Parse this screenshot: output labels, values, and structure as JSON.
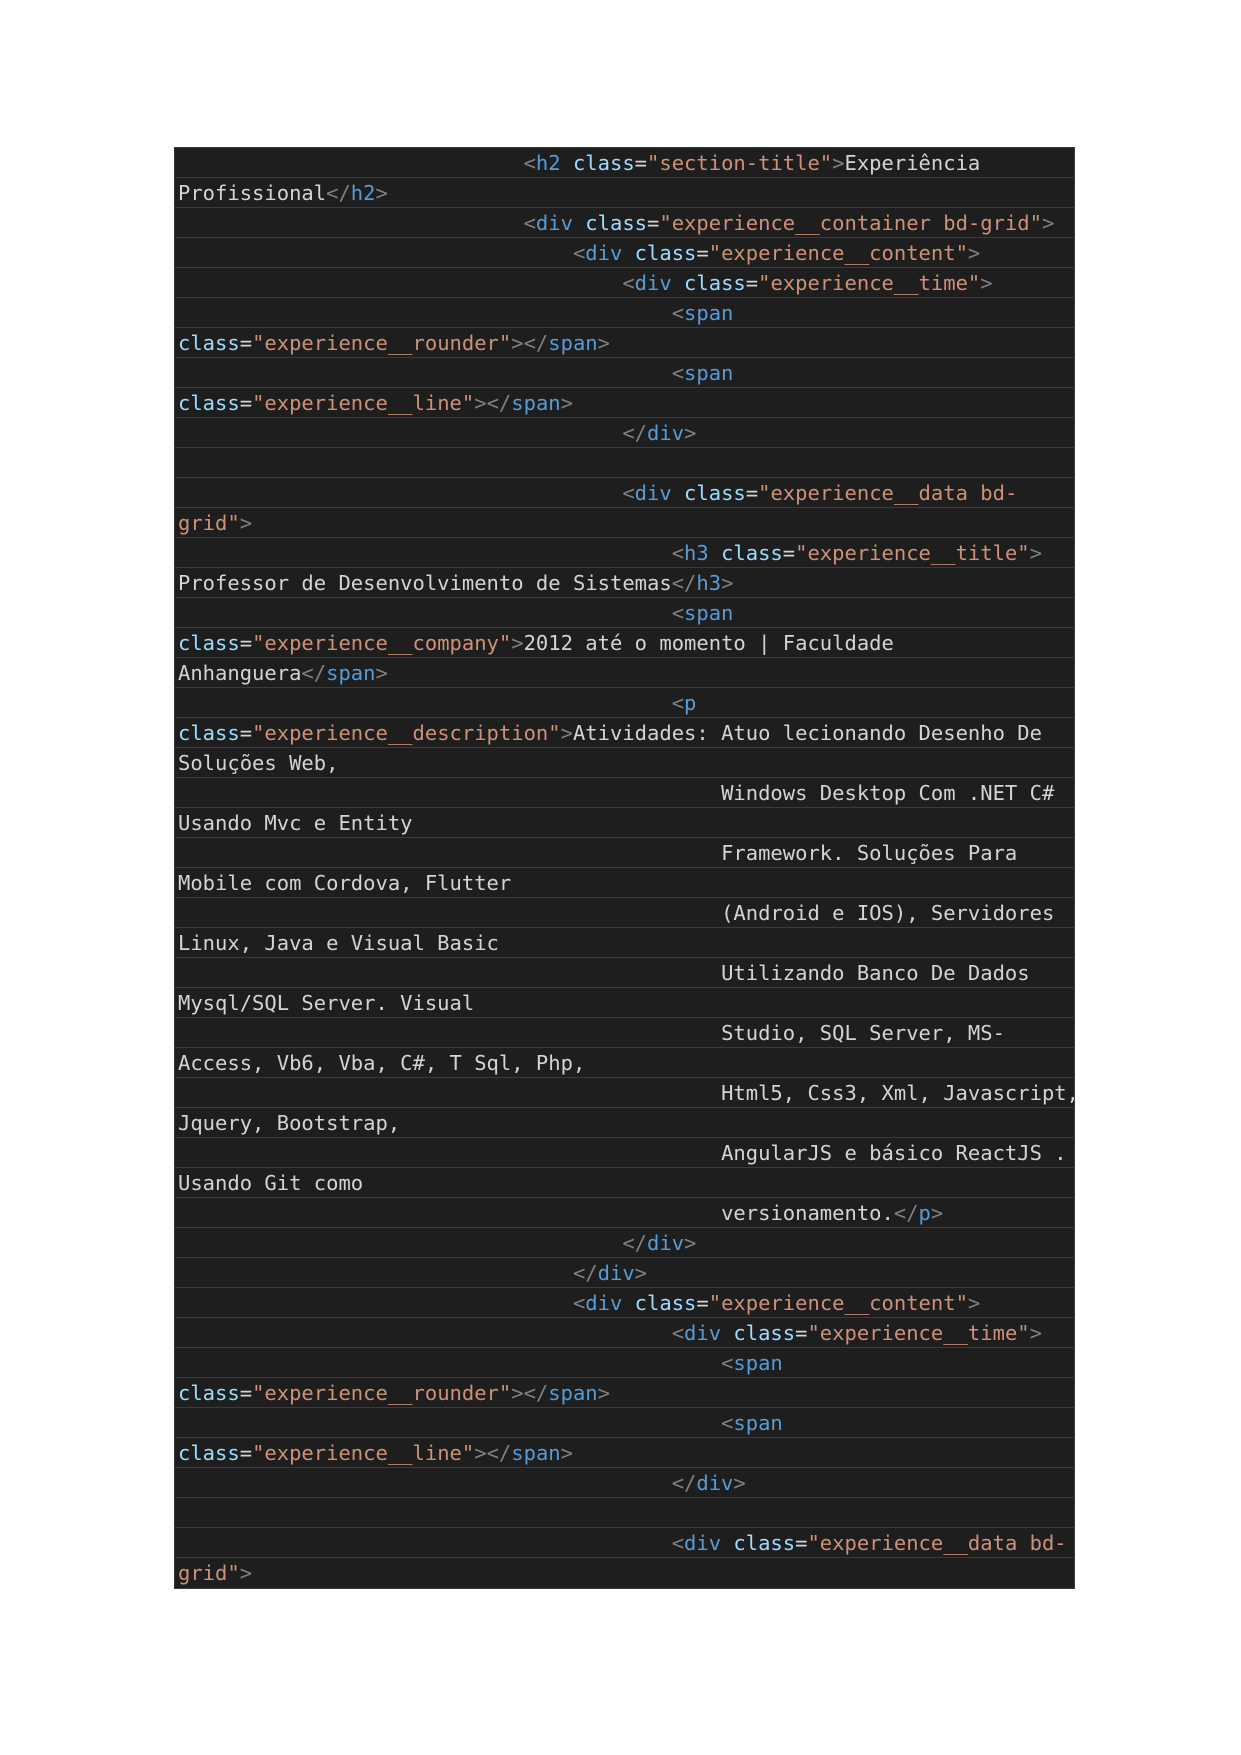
{
  "document": {
    "kind": "code-screenshot",
    "language": "html",
    "colors": {
      "background": "#1e1e1e",
      "punctuation": "#808080",
      "tag": "#569cd6",
      "attribute": "#9cdcfe",
      "string": "#ce9178",
      "text": "#d4d4d4"
    },
    "lines": [
      [
        [
          "",
          "                            "
        ],
        [
          "p",
          "<"
        ],
        [
          "tag",
          "h2"
        ],
        [
          "text",
          " "
        ],
        [
          "attr",
          "class"
        ],
        [
          "text",
          "="
        ],
        [
          "val",
          "\"section-title\""
        ],
        [
          "p",
          ">"
        ],
        [
          "text",
          "Experiência"
        ]
      ],
      [
        [
          "text",
          "Profissional"
        ],
        [
          "p",
          "</"
        ],
        [
          "tag",
          "h2"
        ],
        [
          "p",
          ">"
        ]
      ],
      [
        [
          "",
          "                            "
        ],
        [
          "p",
          "<"
        ],
        [
          "tag",
          "div"
        ],
        [
          "text",
          " "
        ],
        [
          "attr",
          "class"
        ],
        [
          "text",
          "="
        ],
        [
          "val",
          "\"experience__container bd-grid\""
        ],
        [
          "p",
          ">"
        ]
      ],
      [
        [
          "",
          "                                "
        ],
        [
          "p",
          "<"
        ],
        [
          "tag",
          "div"
        ],
        [
          "text",
          " "
        ],
        [
          "attr",
          "class"
        ],
        [
          "text",
          "="
        ],
        [
          "val",
          "\"experience__content\""
        ],
        [
          "p",
          ">"
        ]
      ],
      [
        [
          "",
          "                                    "
        ],
        [
          "p",
          "<"
        ],
        [
          "tag",
          "div"
        ],
        [
          "text",
          " "
        ],
        [
          "attr",
          "class"
        ],
        [
          "text",
          "="
        ],
        [
          "val",
          "\"experience__time\""
        ],
        [
          "p",
          ">"
        ]
      ],
      [
        [
          "",
          "                                        "
        ],
        [
          "p",
          "<"
        ],
        [
          "tag",
          "span"
        ]
      ],
      [
        [
          "attr",
          "class"
        ],
        [
          "text",
          "="
        ],
        [
          "val",
          "\"experience__rounder\""
        ],
        [
          "p",
          "></"
        ],
        [
          "tag",
          "span"
        ],
        [
          "p",
          ">"
        ]
      ],
      [
        [
          "",
          "                                        "
        ],
        [
          "p",
          "<"
        ],
        [
          "tag",
          "span"
        ]
      ],
      [
        [
          "attr",
          "class"
        ],
        [
          "text",
          "="
        ],
        [
          "val",
          "\"experience__line\""
        ],
        [
          "p",
          "></"
        ],
        [
          "tag",
          "span"
        ],
        [
          "p",
          ">"
        ]
      ],
      [
        [
          "",
          "                                    "
        ],
        [
          "p",
          "</"
        ],
        [
          "tag",
          "div"
        ],
        [
          "p",
          ">"
        ]
      ],
      [],
      [
        [
          "",
          "                                    "
        ],
        [
          "p",
          "<"
        ],
        [
          "tag",
          "div"
        ],
        [
          "text",
          " "
        ],
        [
          "attr",
          "class"
        ],
        [
          "text",
          "="
        ],
        [
          "val",
          "\"experience__data bd-"
        ]
      ],
      [
        [
          "val",
          "grid\""
        ],
        [
          "p",
          ">"
        ]
      ],
      [
        [
          "",
          "                                        "
        ],
        [
          "p",
          "<"
        ],
        [
          "tag",
          "h3"
        ],
        [
          "text",
          " "
        ],
        [
          "attr",
          "class"
        ],
        [
          "text",
          "="
        ],
        [
          "val",
          "\"experience__title\""
        ],
        [
          "p",
          ">"
        ]
      ],
      [
        [
          "text",
          "Professor de Desenvolvimento de Sistemas"
        ],
        [
          "p",
          "</"
        ],
        [
          "tag",
          "h3"
        ],
        [
          "p",
          ">"
        ]
      ],
      [
        [
          "",
          "                                        "
        ],
        [
          "p",
          "<"
        ],
        [
          "tag",
          "span"
        ]
      ],
      [
        [
          "attr",
          "class"
        ],
        [
          "text",
          "="
        ],
        [
          "val",
          "\"experience__company\""
        ],
        [
          "p",
          ">"
        ],
        [
          "text",
          "2012 até o momento | Faculdade"
        ]
      ],
      [
        [
          "text",
          "Anhanguera"
        ],
        [
          "p",
          "</"
        ],
        [
          "tag",
          "span"
        ],
        [
          "p",
          ">"
        ]
      ],
      [
        [
          "",
          "                                        "
        ],
        [
          "p",
          "<"
        ],
        [
          "tag",
          "p"
        ]
      ],
      [
        [
          "attr",
          "class"
        ],
        [
          "text",
          "="
        ],
        [
          "val",
          "\"experience__description\""
        ],
        [
          "p",
          ">"
        ],
        [
          "text",
          "Atividades: Atuo lecionando Desenho De"
        ]
      ],
      [
        [
          "text",
          "Soluções Web,"
        ]
      ],
      [
        [
          "",
          "                                            "
        ],
        [
          "text",
          "Windows Desktop Com .NET C#"
        ]
      ],
      [
        [
          "text",
          "Usando Mvc e Entity"
        ]
      ],
      [
        [
          "",
          "                                            "
        ],
        [
          "text",
          "Framework. Soluções Para"
        ]
      ],
      [
        [
          "text",
          "Mobile com Cordova, Flutter"
        ]
      ],
      [
        [
          "",
          "                                            "
        ],
        [
          "text",
          "(Android e IOS), Servidores"
        ]
      ],
      [
        [
          "text",
          "Linux, Java e Visual Basic"
        ]
      ],
      [
        [
          "",
          "                                            "
        ],
        [
          "text",
          "Utilizando Banco De Dados"
        ]
      ],
      [
        [
          "text",
          "Mysql/SQL Server. Visual"
        ]
      ],
      [
        [
          "",
          "                                            "
        ],
        [
          "text",
          "Studio, SQL Server, MS-"
        ]
      ],
      [
        [
          "text",
          "Access, Vb6, Vba, C#, T Sql, Php,"
        ]
      ],
      [
        [
          "",
          "                                            "
        ],
        [
          "text",
          "Html5, Css3, Xml, Javascript,"
        ]
      ],
      [
        [
          "text",
          "Jquery, Bootstrap,"
        ]
      ],
      [
        [
          "",
          "                                            "
        ],
        [
          "text",
          "AngularJS e básico ReactJS ."
        ]
      ],
      [
        [
          "text",
          "Usando Git como"
        ]
      ],
      [
        [
          "",
          "                                            "
        ],
        [
          "text",
          "versionamento."
        ],
        [
          "p",
          "</"
        ],
        [
          "tag",
          "p"
        ],
        [
          "p",
          ">"
        ]
      ],
      [
        [
          "",
          "                                    "
        ],
        [
          "p",
          "</"
        ],
        [
          "tag",
          "div"
        ],
        [
          "p",
          ">"
        ]
      ],
      [
        [
          "",
          "                                "
        ],
        [
          "p",
          "</"
        ],
        [
          "tag",
          "div"
        ],
        [
          "p",
          ">"
        ]
      ],
      [
        [
          "",
          "                                "
        ],
        [
          "p",
          "<"
        ],
        [
          "tag",
          "div"
        ],
        [
          "text",
          " "
        ],
        [
          "attr",
          "class"
        ],
        [
          "text",
          "="
        ],
        [
          "val",
          "\"experience__content\""
        ],
        [
          "p",
          ">"
        ]
      ],
      [
        [
          "",
          "                                        "
        ],
        [
          "p",
          "<"
        ],
        [
          "tag",
          "div"
        ],
        [
          "text",
          " "
        ],
        [
          "attr",
          "class"
        ],
        [
          "text",
          "="
        ],
        [
          "val",
          "\"experience__time\""
        ],
        [
          "p",
          ">"
        ]
      ],
      [
        [
          "",
          "                                            "
        ],
        [
          "p",
          "<"
        ],
        [
          "tag",
          "span"
        ]
      ],
      [
        [
          "attr",
          "class"
        ],
        [
          "text",
          "="
        ],
        [
          "val",
          "\"experience__rounder\""
        ],
        [
          "p",
          "></"
        ],
        [
          "tag",
          "span"
        ],
        [
          "p",
          ">"
        ]
      ],
      [
        [
          "",
          "                                            "
        ],
        [
          "p",
          "<"
        ],
        [
          "tag",
          "span"
        ]
      ],
      [
        [
          "attr",
          "class"
        ],
        [
          "text",
          "="
        ],
        [
          "val",
          "\"experience__line\""
        ],
        [
          "p",
          "></"
        ],
        [
          "tag",
          "span"
        ],
        [
          "p",
          ">"
        ]
      ],
      [
        [
          "",
          "                                        "
        ],
        [
          "p",
          "</"
        ],
        [
          "tag",
          "div"
        ],
        [
          "p",
          ">"
        ]
      ],
      [],
      [
        [
          "",
          "                                        "
        ],
        [
          "p",
          "<"
        ],
        [
          "tag",
          "div"
        ],
        [
          "text",
          " "
        ],
        [
          "attr",
          "class"
        ],
        [
          "text",
          "="
        ],
        [
          "val",
          "\"experience__data bd-"
        ]
      ],
      [
        [
          "val",
          "grid\""
        ],
        [
          "p",
          ">"
        ]
      ]
    ]
  }
}
